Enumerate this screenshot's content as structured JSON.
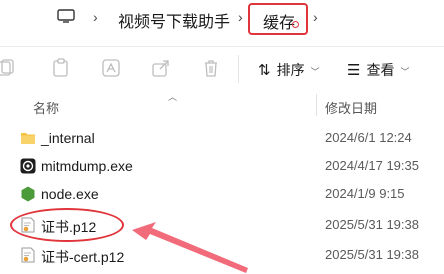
{
  "address_bar": {
    "crumbs": [
      "视频号下载助手",
      "缓存"
    ]
  },
  "toolbar": {
    "sort_label": "排序",
    "view_label": "查看"
  },
  "columns": {
    "name": "名称",
    "date_modified": "修改日期"
  },
  "files": [
    {
      "name": "_internal",
      "date": "2024/6/1 12:24",
      "icon": "folder-icon"
    },
    {
      "name": "mitmdump.exe",
      "date": "2024/4/17 19:35",
      "icon": "mitmdump-exe-icon"
    },
    {
      "name": "node.exe",
      "date": "2024/1/9 9:15",
      "icon": "node-hexagon-icon"
    },
    {
      "name": "证书.p12",
      "date": "2025/5/31 19:38",
      "icon": "certificate-icon"
    },
    {
      "name": "证书-cert.p12",
      "date": "2025/5/31 19:38",
      "icon": "certificate-icon"
    }
  ],
  "colors": {
    "annotation_red": "#e0353b",
    "folder_yellow": "#f5c242",
    "node_green": "#4b9b3a"
  }
}
